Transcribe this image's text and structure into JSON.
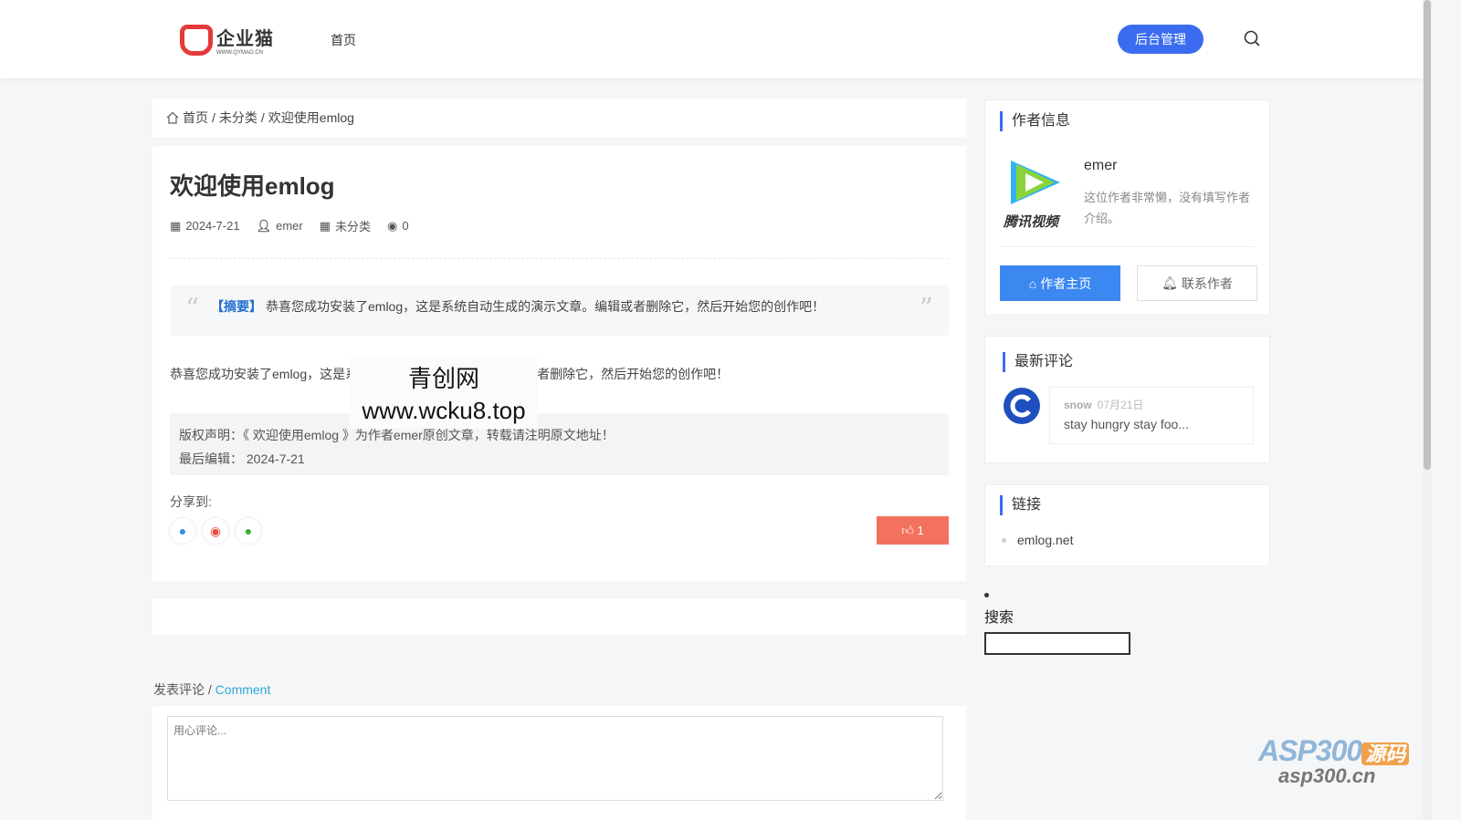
{
  "header": {
    "logo_text": "企业猫",
    "logo_sub": "WWW.QYMAO.CN",
    "nav": [
      "首页"
    ],
    "admin_button": "后台管理"
  },
  "breadcrumb": [
    "首页",
    "/",
    "未分类",
    "/",
    "欢迎使用emlog"
  ],
  "article": {
    "title": "欢迎使用emlog",
    "date": "2024-7-21",
    "author": "emer",
    "category": "未分类",
    "views": "0",
    "summary_tag": "【摘要】",
    "summary": "恭喜您成功安装了emlog，这是系统自动生成的演示文章。编辑或者删除它，然后开始您的创作吧！",
    "body": "恭喜您成功安装了emlog，这是系统自动生成的演示文章。编辑或者删除它，然后开始您的创作吧！",
    "copyright": "版权声明：《 欢迎使用emlog 》为作者emer原创文章，转载请注明原文地址！",
    "last_edit": "最后编辑： 2024-7-21",
    "share_label": "分享到:",
    "likes": "1"
  },
  "watermark": {
    "line1": "青创网",
    "line2": "www.wcku8.top"
  },
  "comment": {
    "heading": "发表评论",
    "sep": " / ",
    "heading_en": "Comment",
    "placeholder": "用心评论..."
  },
  "sidebar": {
    "author_title": "作者信息",
    "author_logo_text": "腾讯视频",
    "author_name": "emer",
    "author_desc": "这位作者非常懒，没有填写作者介绍。",
    "home_button": "作者主页",
    "contact_button": "联系作者",
    "comments_title": "最新评论",
    "comments": [
      {
        "name": "snow",
        "date": "07月21日",
        "text": "stay hungry stay foo..."
      }
    ],
    "links_title": "链接",
    "links": [
      "emlog.net"
    ],
    "search_title": "搜索"
  },
  "corner": {
    "a": "ASP300",
    "b": "源码",
    "c": "asp300.cn"
  }
}
